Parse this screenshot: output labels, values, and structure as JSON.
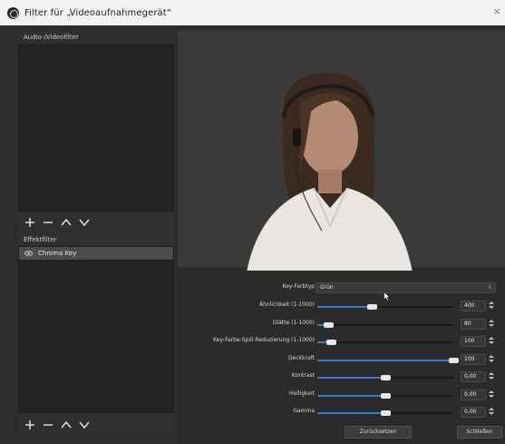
{
  "window": {
    "title": "Filter für „Videoaufnahmegerät“",
    "close": "×"
  },
  "audio_video_filters": {
    "label": "Audio-/Videofilter"
  },
  "effect_filters": {
    "label": "Effektfilter",
    "items": [
      {
        "label": "Chroma Key",
        "visible": true
      }
    ]
  },
  "properties": {
    "key_color_type": {
      "label": "Key-Farbtyp",
      "value": "Grün"
    },
    "sliders": [
      {
        "label": "Ähnlichkeit (1-1000)",
        "value": "400",
        "fraction": 0.4
      },
      {
        "label": "Glätte (1-1000)",
        "value": "80",
        "fraction": 0.08
      },
      {
        "label": "Key-Farbe-Spill-Reduzierung (1-1000)",
        "value": "100",
        "fraction": 0.1
      },
      {
        "label": "Deckkraft",
        "value": "100",
        "fraction": 1.0
      },
      {
        "label": "Kontrast",
        "value": "0,00",
        "fraction": 0.5
      },
      {
        "label": "Helligkeit",
        "value": "0,00",
        "fraction": 0.5
      },
      {
        "label": "Gamma",
        "value": "0,00",
        "fraction": 0.5
      }
    ]
  },
  "buttons": {
    "reset": "Zurücksetzen",
    "close": "Schließen"
  },
  "colors": {
    "accent": "#2f7fd6",
    "panel": "#2d2d2d",
    "list": "#232323",
    "selected_item": "#4c4c4c"
  }
}
